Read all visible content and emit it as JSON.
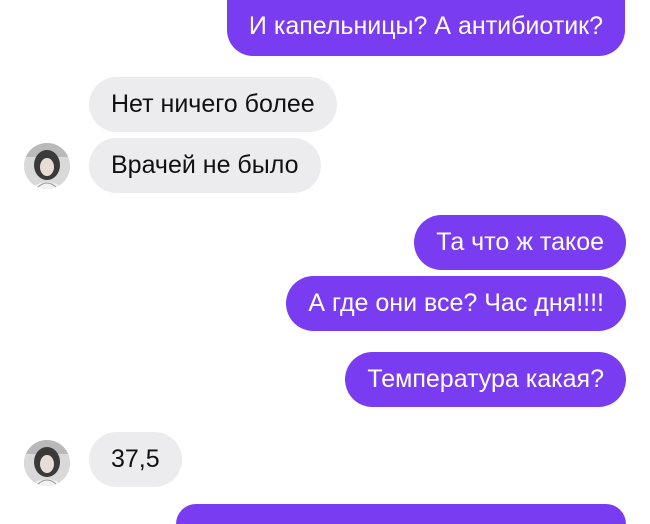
{
  "messages": [
    {
      "side": "outgoing",
      "text": "И капельницы? А антибиотик?"
    },
    {
      "side": "incoming",
      "text": "Нет ничего более"
    },
    {
      "side": "incoming",
      "text": "Врачей не было"
    },
    {
      "side": "outgoing",
      "text": "Та что ж такое"
    },
    {
      "side": "outgoing",
      "text": "А где они все? Час дня!!!!"
    },
    {
      "side": "outgoing",
      "text": "Температура какая?"
    },
    {
      "side": "incoming",
      "text": "37,5"
    },
    {
      "side": "outgoing",
      "text": ""
    }
  ],
  "colors": {
    "outgoing_bubble": "#7a3cf0",
    "incoming_bubble": "#ececee",
    "incoming_text": "#111111",
    "outgoing_text": "#ffffff"
  },
  "icons": {
    "avatar": "contact-avatar-photo"
  }
}
